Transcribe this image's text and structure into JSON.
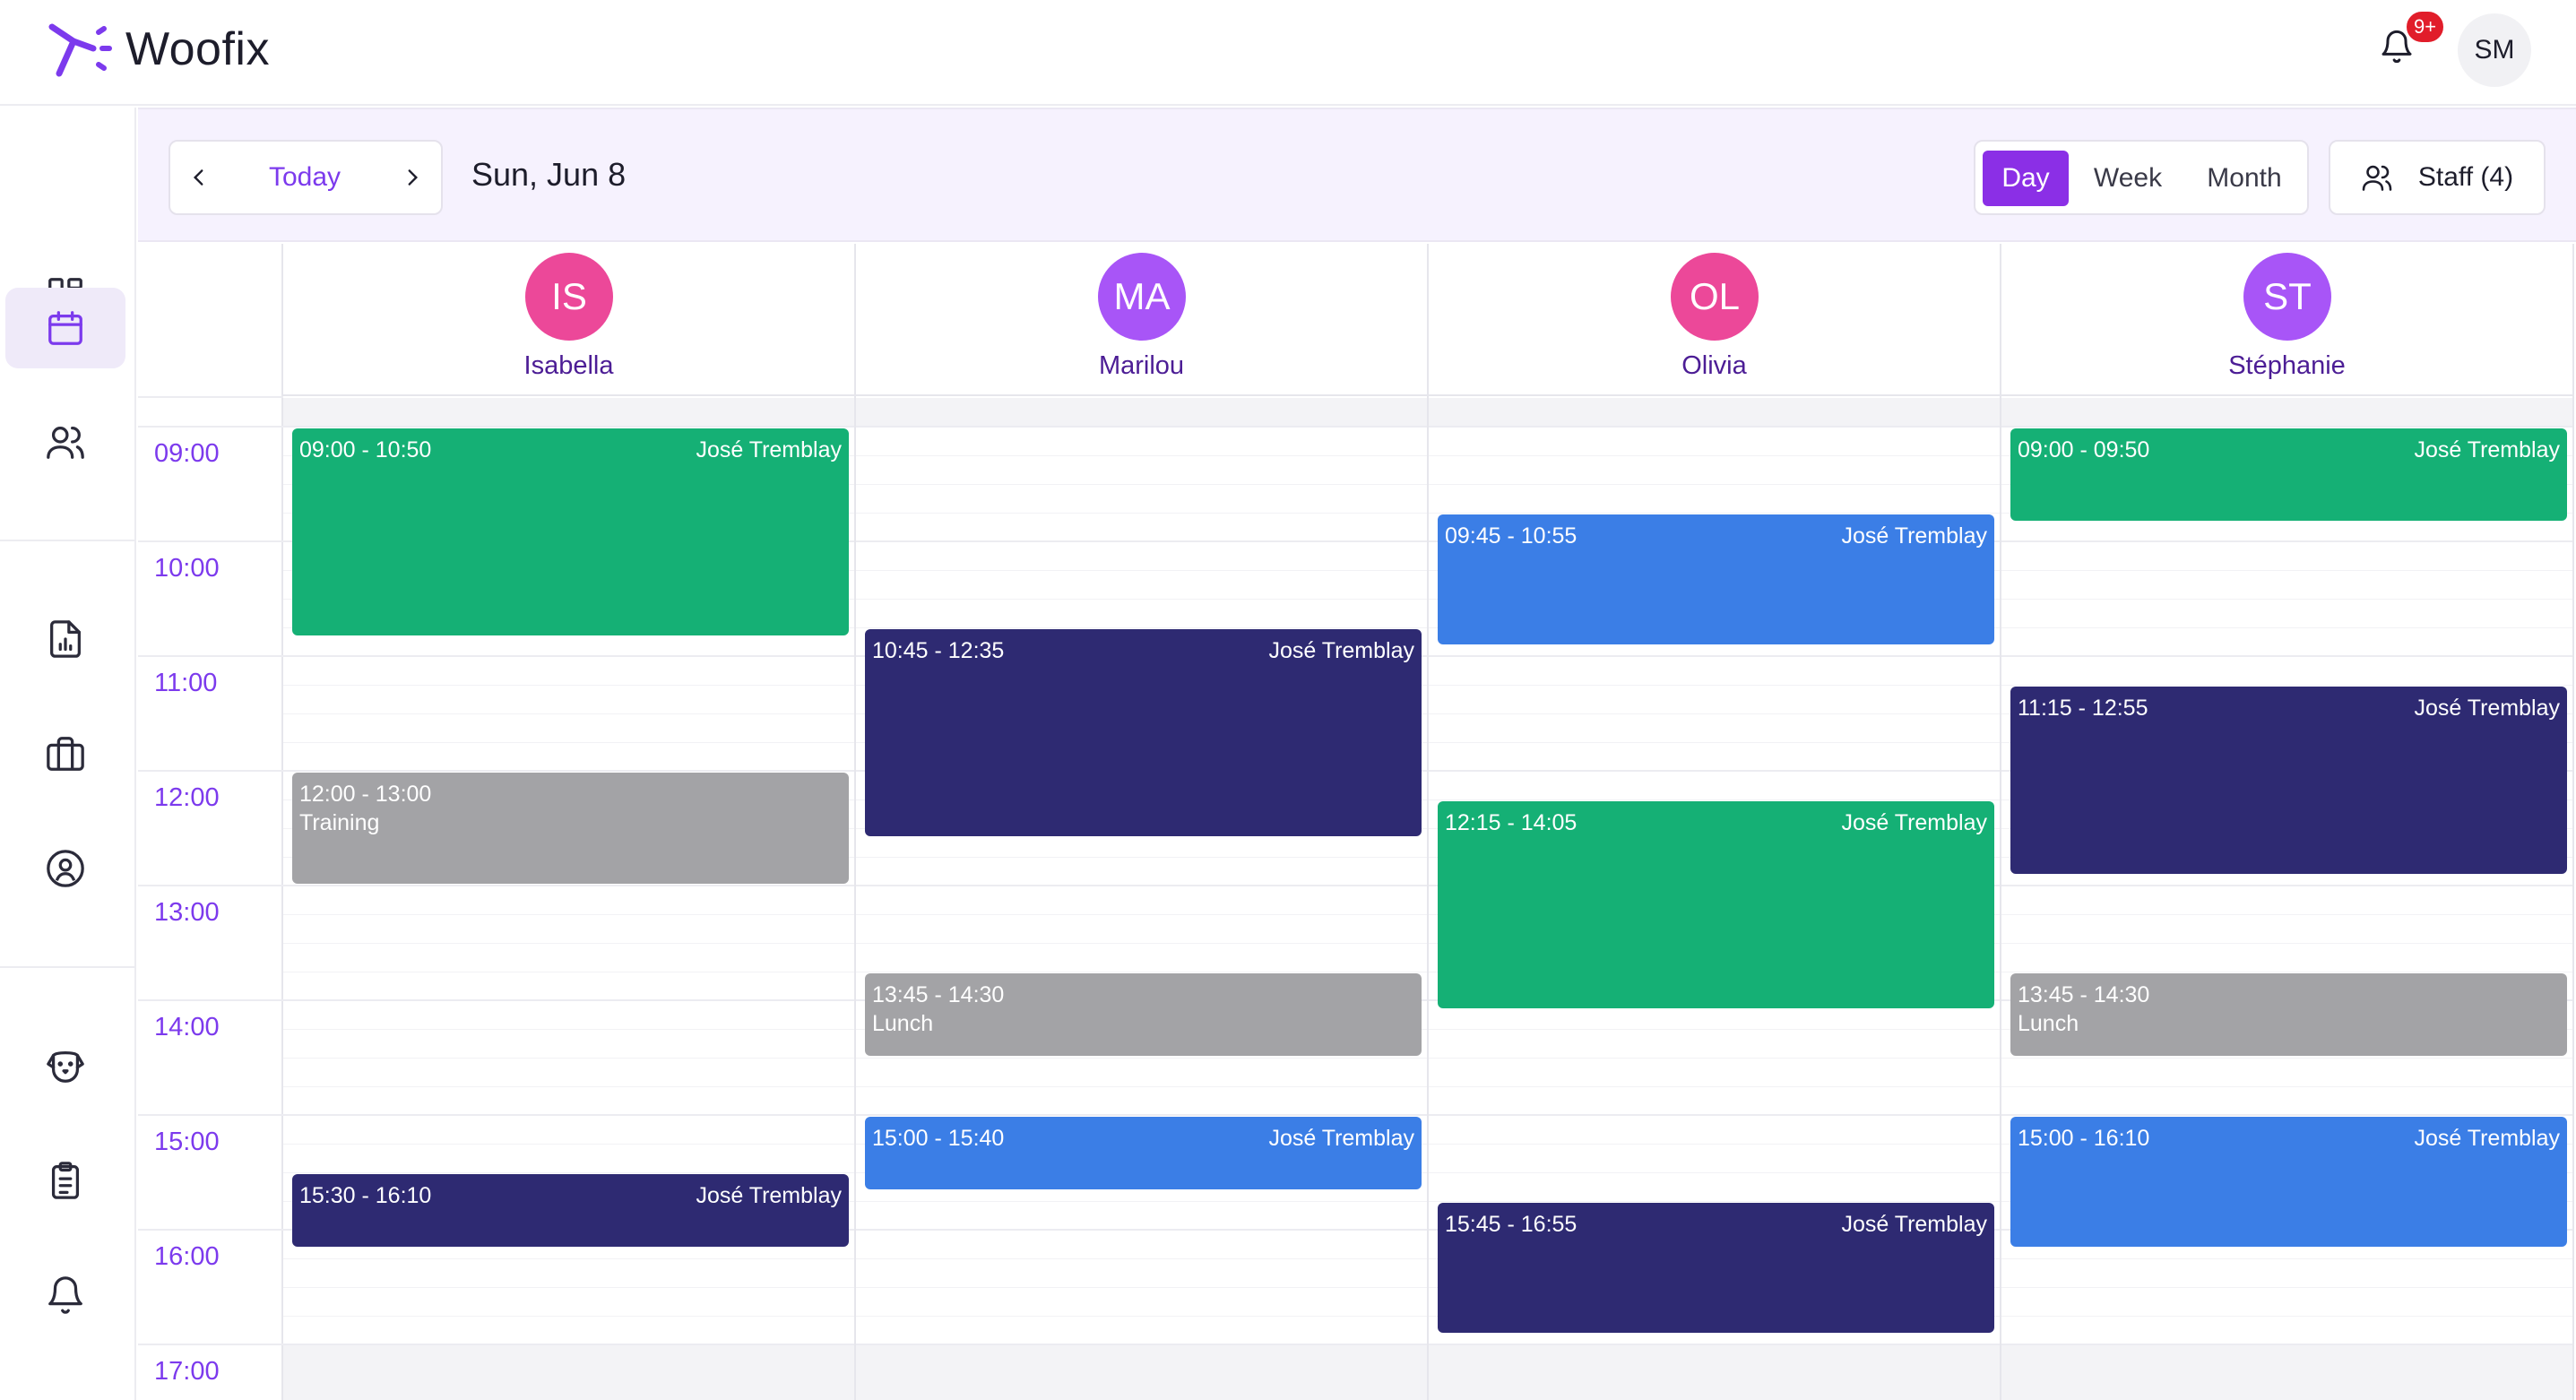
{
  "app": {
    "name": "Woofix",
    "brand_color": "#8b2fe6"
  },
  "header": {
    "notification_count": "9+",
    "user_initials": "SM"
  },
  "sidebar": {
    "items": [
      {
        "icon": "dashboard-icon",
        "active": false
      },
      {
        "icon": "calendar-icon",
        "active": true
      },
      {
        "icon": "users-icon",
        "active": false
      },
      {
        "icon": "report-icon",
        "active": false
      },
      {
        "icon": "briefcase-icon",
        "active": false
      },
      {
        "icon": "user-circle-icon",
        "active": false
      },
      {
        "icon": "dog-icon",
        "active": false
      },
      {
        "icon": "clipboard-icon",
        "active": false
      },
      {
        "icon": "bell-icon",
        "active": false
      }
    ]
  },
  "toolbar": {
    "today_label": "Today",
    "date_title": "Sun, Jun 8",
    "views": [
      "Day",
      "Week",
      "Month"
    ],
    "active_view": "Day",
    "staff_label": "Staff (4)"
  },
  "time_labels": [
    "09:00",
    "10:00",
    "11:00",
    "12:00",
    "13:00",
    "14:00",
    "15:00",
    "16:00",
    "17:00"
  ],
  "staff": [
    {
      "initials": "IS",
      "name": "Isabella",
      "color": "#ec4899"
    },
    {
      "initials": "MA",
      "name": "Marilou",
      "color": "#a855f7"
    },
    {
      "initials": "OL",
      "name": "Olivia",
      "color": "#ec4899"
    },
    {
      "initials": "ST",
      "name": "Stéphanie",
      "color": "#a855f7"
    }
  ],
  "events": [
    [
      {
        "time": "09:00 - 10:50",
        "start": "09:00",
        "end": "10:50",
        "client": "José Tremblay",
        "title": "",
        "type": "green"
      },
      {
        "time": "12:00 - 13:00",
        "start": "12:00",
        "end": "13:00",
        "client": "",
        "title": "Training",
        "type": "gray"
      },
      {
        "time": "15:30 - 16:10",
        "start": "15:30",
        "end": "16:10",
        "client": "José Tremblay",
        "title": "",
        "type": "navy"
      }
    ],
    [
      {
        "time": "10:45 - 12:35",
        "start": "10:45",
        "end": "12:35",
        "client": "José Tremblay",
        "title": "",
        "type": "navy"
      },
      {
        "time": "13:45 - 14:30",
        "start": "13:45",
        "end": "14:30",
        "client": "",
        "title": "Lunch",
        "type": "gray"
      },
      {
        "time": "15:00 - 15:40",
        "start": "15:00",
        "end": "15:40",
        "client": "José Tremblay",
        "title": "",
        "type": "blue"
      }
    ],
    [
      {
        "time": "09:45 - 10:55",
        "start": "09:45",
        "end": "10:55",
        "client": "José Tremblay",
        "title": "",
        "type": "blue"
      },
      {
        "time": "12:15 - 14:05",
        "start": "12:15",
        "end": "14:05",
        "client": "José Tremblay",
        "title": "",
        "type": "green"
      },
      {
        "time": "15:45 - 16:55",
        "start": "15:45",
        "end": "16:55",
        "client": "José Tremblay",
        "title": "",
        "type": "navy"
      }
    ],
    [
      {
        "time": "09:00 - 09:50",
        "start": "09:00",
        "end": "09:50",
        "client": "José Tremblay",
        "title": "",
        "type": "green"
      },
      {
        "time": "11:15 - 12:55",
        "start": "11:15",
        "end": "12:55",
        "client": "José Tremblay",
        "title": "",
        "type": "navy"
      },
      {
        "time": "13:45 - 14:30",
        "start": "13:45",
        "end": "14:30",
        "client": "",
        "title": "Lunch",
        "type": "gray"
      },
      {
        "time": "15:00 - 16:10",
        "start": "15:00",
        "end": "16:10",
        "client": "José Tremblay",
        "title": "",
        "type": "blue"
      }
    ]
  ]
}
